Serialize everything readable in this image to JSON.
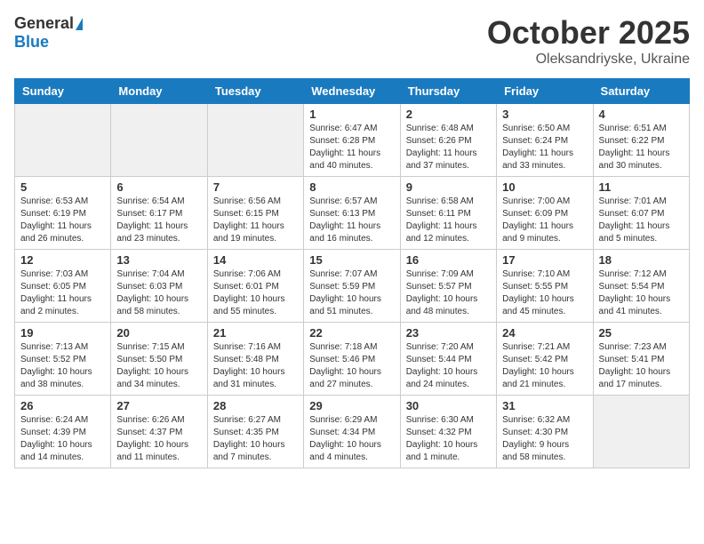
{
  "header": {
    "logo_general": "General",
    "logo_blue": "Blue",
    "month_title": "October 2025",
    "location": "Oleksandriyske, Ukraine"
  },
  "weekdays": [
    "Sunday",
    "Monday",
    "Tuesday",
    "Wednesday",
    "Thursday",
    "Friday",
    "Saturday"
  ],
  "weeks": [
    [
      {
        "day": "",
        "info": ""
      },
      {
        "day": "",
        "info": ""
      },
      {
        "day": "",
        "info": ""
      },
      {
        "day": "1",
        "info": "Sunrise: 6:47 AM\nSunset: 6:28 PM\nDaylight: 11 hours\nand 40 minutes."
      },
      {
        "day": "2",
        "info": "Sunrise: 6:48 AM\nSunset: 6:26 PM\nDaylight: 11 hours\nand 37 minutes."
      },
      {
        "day": "3",
        "info": "Sunrise: 6:50 AM\nSunset: 6:24 PM\nDaylight: 11 hours\nand 33 minutes."
      },
      {
        "day": "4",
        "info": "Sunrise: 6:51 AM\nSunset: 6:22 PM\nDaylight: 11 hours\nand 30 minutes."
      }
    ],
    [
      {
        "day": "5",
        "info": "Sunrise: 6:53 AM\nSunset: 6:19 PM\nDaylight: 11 hours\nand 26 minutes."
      },
      {
        "day": "6",
        "info": "Sunrise: 6:54 AM\nSunset: 6:17 PM\nDaylight: 11 hours\nand 23 minutes."
      },
      {
        "day": "7",
        "info": "Sunrise: 6:56 AM\nSunset: 6:15 PM\nDaylight: 11 hours\nand 19 minutes."
      },
      {
        "day": "8",
        "info": "Sunrise: 6:57 AM\nSunset: 6:13 PM\nDaylight: 11 hours\nand 16 minutes."
      },
      {
        "day": "9",
        "info": "Sunrise: 6:58 AM\nSunset: 6:11 PM\nDaylight: 11 hours\nand 12 minutes."
      },
      {
        "day": "10",
        "info": "Sunrise: 7:00 AM\nSunset: 6:09 PM\nDaylight: 11 hours\nand 9 minutes."
      },
      {
        "day": "11",
        "info": "Sunrise: 7:01 AM\nSunset: 6:07 PM\nDaylight: 11 hours\nand 5 minutes."
      }
    ],
    [
      {
        "day": "12",
        "info": "Sunrise: 7:03 AM\nSunset: 6:05 PM\nDaylight: 11 hours\nand 2 minutes."
      },
      {
        "day": "13",
        "info": "Sunrise: 7:04 AM\nSunset: 6:03 PM\nDaylight: 10 hours\nand 58 minutes."
      },
      {
        "day": "14",
        "info": "Sunrise: 7:06 AM\nSunset: 6:01 PM\nDaylight: 10 hours\nand 55 minutes."
      },
      {
        "day": "15",
        "info": "Sunrise: 7:07 AM\nSunset: 5:59 PM\nDaylight: 10 hours\nand 51 minutes."
      },
      {
        "day": "16",
        "info": "Sunrise: 7:09 AM\nSunset: 5:57 PM\nDaylight: 10 hours\nand 48 minutes."
      },
      {
        "day": "17",
        "info": "Sunrise: 7:10 AM\nSunset: 5:55 PM\nDaylight: 10 hours\nand 45 minutes."
      },
      {
        "day": "18",
        "info": "Sunrise: 7:12 AM\nSunset: 5:54 PM\nDaylight: 10 hours\nand 41 minutes."
      }
    ],
    [
      {
        "day": "19",
        "info": "Sunrise: 7:13 AM\nSunset: 5:52 PM\nDaylight: 10 hours\nand 38 minutes."
      },
      {
        "day": "20",
        "info": "Sunrise: 7:15 AM\nSunset: 5:50 PM\nDaylight: 10 hours\nand 34 minutes."
      },
      {
        "day": "21",
        "info": "Sunrise: 7:16 AM\nSunset: 5:48 PM\nDaylight: 10 hours\nand 31 minutes."
      },
      {
        "day": "22",
        "info": "Sunrise: 7:18 AM\nSunset: 5:46 PM\nDaylight: 10 hours\nand 27 minutes."
      },
      {
        "day": "23",
        "info": "Sunrise: 7:20 AM\nSunset: 5:44 PM\nDaylight: 10 hours\nand 24 minutes."
      },
      {
        "day": "24",
        "info": "Sunrise: 7:21 AM\nSunset: 5:42 PM\nDaylight: 10 hours\nand 21 minutes."
      },
      {
        "day": "25",
        "info": "Sunrise: 7:23 AM\nSunset: 5:41 PM\nDaylight: 10 hours\nand 17 minutes."
      }
    ],
    [
      {
        "day": "26",
        "info": "Sunrise: 6:24 AM\nSunset: 4:39 PM\nDaylight: 10 hours\nand 14 minutes."
      },
      {
        "day": "27",
        "info": "Sunrise: 6:26 AM\nSunset: 4:37 PM\nDaylight: 10 hours\nand 11 minutes."
      },
      {
        "day": "28",
        "info": "Sunrise: 6:27 AM\nSunset: 4:35 PM\nDaylight: 10 hours\nand 7 minutes."
      },
      {
        "day": "29",
        "info": "Sunrise: 6:29 AM\nSunset: 4:34 PM\nDaylight: 10 hours\nand 4 minutes."
      },
      {
        "day": "30",
        "info": "Sunrise: 6:30 AM\nSunset: 4:32 PM\nDaylight: 10 hours\nand 1 minute."
      },
      {
        "day": "31",
        "info": "Sunrise: 6:32 AM\nSunset: 4:30 PM\nDaylight: 9 hours\nand 58 minutes."
      },
      {
        "day": "",
        "info": ""
      }
    ]
  ]
}
